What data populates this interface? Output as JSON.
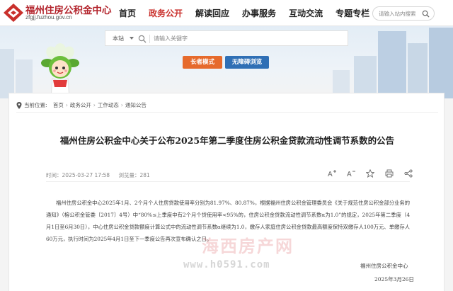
{
  "header": {
    "site_name": "福州住房公积金中心",
    "site_domain": "zfgjj.fuzhou.gov.cn",
    "nav": [
      "首页",
      "政务公开",
      "解读回应",
      "办事服务",
      "互动交流",
      "专题专栏"
    ],
    "search_placeholder": "请输入站内搜索"
  },
  "banner": {
    "scope_label": "本站",
    "search_placeholder": "请输入关键字",
    "elder_mode_label": "长者模式",
    "accessible_label": "无障碍浏览"
  },
  "breadcrumb": {
    "prefix": "当前位置:",
    "items": [
      "首页",
      "政务公开",
      "工作动态",
      "通知公告"
    ]
  },
  "article": {
    "title": "福州住房公积金中心关于公布2025年第二季度住房公积金贷款流动性调节系数的公告",
    "time": "时间：2025-03-27 17:58",
    "views": "浏览量：281",
    "body": "福州住房公积金中心2025年1月、2个月个人住房贷款使用率分别为81.97%、80.87%，根据福州住房公积金管理委员会《关于规范住房公积金部分业务的通知》（榕公积金管委〔2017〕4号）中“80%≤上季度中有2个月个贷使用率<95%的，住房公积金贷款流动性调节系数α为1.0”的规定，2025年第二季度（4月1日至6月30日），中心住房公积金贷款额度计算公式中的流动性调节系数α继续为1.0，缴存人家庭住房公积金贷款最高额度保持双缴存人100万元、单缴存人60万元，执行时间为2025年4月1日至下一季度公告再次宣布确认之日。",
    "signature": "福州住房公积金中心",
    "date": "2025年3月26日"
  },
  "watermark": {
    "line1": "海西房产网",
    "line2": "www.h0591.com"
  },
  "colors": {
    "brand_red": "#c9302c",
    "elder_orange": "#e66a2c",
    "access_blue": "#2f6fb5"
  }
}
